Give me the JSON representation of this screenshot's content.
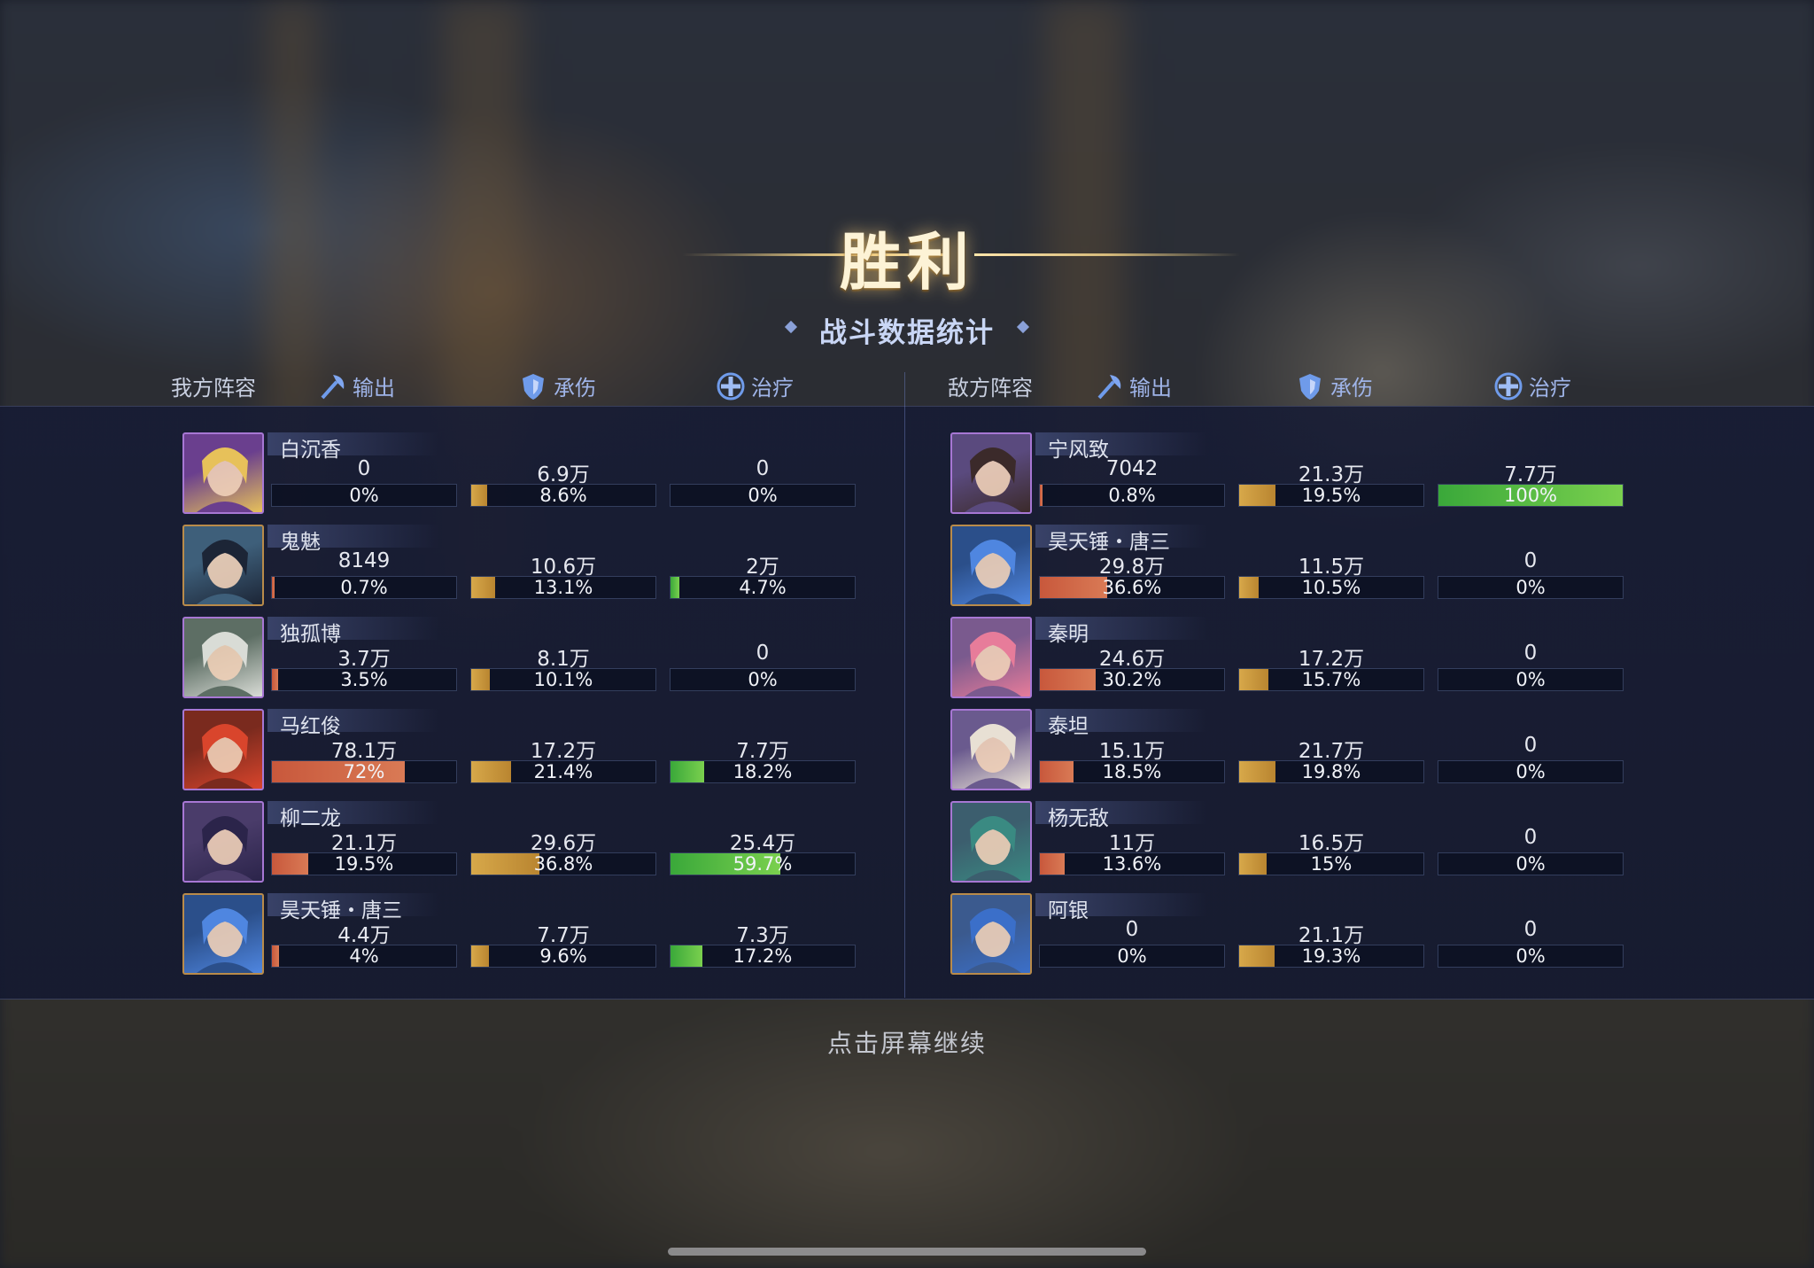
{
  "title": "胜利",
  "subtitle": "战斗数据统计",
  "continue_text": "点击屏幕继续",
  "headers": {
    "ally": "我方阵容",
    "enemy": "敌方阵容",
    "damage": "输出",
    "tank": "承伤",
    "heal": "治疗"
  },
  "colors": {
    "damage": "#c8583c",
    "tank": "#d7a84a",
    "heal": "#3aa83a",
    "panel": "#161b34"
  },
  "ally": [
    {
      "name": "白沉香",
      "portrait": "golden-hair-horns",
      "dmg": "0",
      "dmg_pct": "0%",
      "dmg_f": 0,
      "tank": "6.9万",
      "tank_pct": "8.6%",
      "tank_f": 0.086,
      "heal": "0",
      "heal_pct": "0%",
      "heal_f": 0
    },
    {
      "name": "鬼魅",
      "portrait": "dark-blue-hair",
      "dmg": "8149",
      "dmg_pct": "0.7%",
      "dmg_f": 0.007,
      "tank": "10.6万",
      "tank_pct": "13.1%",
      "tank_f": 0.131,
      "heal": "2万",
      "heal_pct": "4.7%",
      "heal_f": 0.047
    },
    {
      "name": "独孤博",
      "portrait": "white-hair-elder",
      "dmg": "3.7万",
      "dmg_pct": "3.5%",
      "dmg_f": 0.035,
      "tank": "8.1万",
      "tank_pct": "10.1%",
      "tank_f": 0.101,
      "heal": "0",
      "heal_pct": "0%",
      "heal_f": 0
    },
    {
      "name": "马红俊",
      "portrait": "red-hair-chubby",
      "dmg": "78.1万",
      "dmg_pct": "72%",
      "dmg_f": 0.72,
      "tank": "17.2万",
      "tank_pct": "21.4%",
      "tank_f": 0.214,
      "heal": "7.7万",
      "heal_pct": "18.2%",
      "heal_f": 0.182
    },
    {
      "name": "柳二龙",
      "portrait": "purple-hair-woman",
      "dmg": "21.1万",
      "dmg_pct": "19.5%",
      "dmg_f": 0.195,
      "tank": "29.6万",
      "tank_pct": "36.8%",
      "tank_f": 0.368,
      "heal": "25.4万",
      "heal_pct": "59.7%",
      "heal_f": 0.597
    },
    {
      "name": "昊天锤・唐三",
      "portrait": "blue-hair-hero",
      "dmg": "4.4万",
      "dmg_pct": "4%",
      "dmg_f": 0.04,
      "tank": "7.7万",
      "tank_pct": "9.6%",
      "tank_f": 0.096,
      "heal": "7.3万",
      "heal_pct": "17.2%",
      "heal_f": 0.172
    }
  ],
  "enemy": [
    {
      "name": "宁风致",
      "portrait": "long-hair-scholar",
      "dmg": "7042",
      "dmg_pct": "0.8%",
      "dmg_f": 0.008,
      "tank": "21.3万",
      "tank_pct": "19.5%",
      "tank_f": 0.195,
      "heal": "7.7万",
      "heal_pct": "100%",
      "heal_f": 1.0
    },
    {
      "name": "昊天锤・唐三",
      "portrait": "blue-hair-hero",
      "dmg": "29.8万",
      "dmg_pct": "36.6%",
      "dmg_f": 0.366,
      "tank": "11.5万",
      "tank_pct": "10.5%",
      "tank_f": 0.105,
      "heal": "0",
      "heal_pct": "0%",
      "heal_f": 0
    },
    {
      "name": "秦明",
      "portrait": "pink-hair-youth",
      "dmg": "24.6万",
      "dmg_pct": "30.2%",
      "dmg_f": 0.302,
      "tank": "17.2万",
      "tank_pct": "15.7%",
      "tank_f": 0.157,
      "heal": "0",
      "heal_pct": "0%",
      "heal_f": 0
    },
    {
      "name": "泰坦",
      "portrait": "white-beard-giant",
      "dmg": "15.1万",
      "dmg_pct": "18.5%",
      "dmg_f": 0.185,
      "tank": "21.7万",
      "tank_pct": "19.8%",
      "tank_f": 0.198,
      "heal": "0",
      "heal_pct": "0%",
      "heal_f": 0
    },
    {
      "name": "杨无敌",
      "portrait": "teal-hair-warrior",
      "dmg": "11万",
      "dmg_pct": "13.6%",
      "dmg_f": 0.136,
      "tank": "16.5万",
      "tank_pct": "15%",
      "tank_f": 0.15,
      "heal": "0",
      "heal_pct": "0%",
      "heal_f": 0
    },
    {
      "name": "阿银",
      "portrait": "blue-hair-woman",
      "dmg": "0",
      "dmg_pct": "0%",
      "dmg_f": 0,
      "tank": "21.1万",
      "tank_pct": "19.3%",
      "tank_f": 0.193,
      "heal": "0",
      "heal_pct": "0%",
      "heal_f": 0
    }
  ]
}
